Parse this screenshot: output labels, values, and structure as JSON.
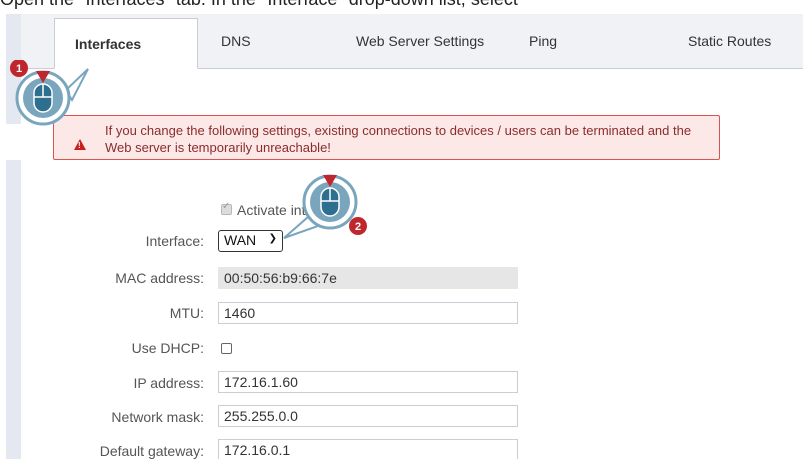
{
  "intro_text": "Open the \"Interfaces\" tab. In the \"Interface\" drop-down list, select",
  "tabs": [
    {
      "label": "Interfaces"
    },
    {
      "label": "DNS"
    },
    {
      "label": "Web Server Settings"
    },
    {
      "label": "Ping"
    },
    {
      "label": "Static Routes"
    }
  ],
  "warning_text": "If you change the following settings, existing connections to devices / users can be terminated and the Web server is temporarily unreachable!",
  "activate_label": "Activate interface",
  "form": {
    "interface_label": "Interface:",
    "interface_value": "WAN",
    "mac_label": "MAC address:",
    "mac_value": "00:50:56:b9:66:7e",
    "mtu_label": "MTU:",
    "mtu_value": "1460",
    "dhcp_label": "Use DHCP:",
    "ip_label": "IP address:",
    "ip_value": "172.16.1.60",
    "mask_label": "Network mask:",
    "mask_value": "255.255.0.0",
    "gateway_label": "Default gateway:",
    "gateway_value": "172.16.0.1"
  },
  "markers": {
    "one": "1",
    "two": "2"
  },
  "colors": {
    "accent_red": "#c0272d",
    "mouse_fill": "#79a6bd",
    "tab_bar": "#f0f2f6"
  }
}
